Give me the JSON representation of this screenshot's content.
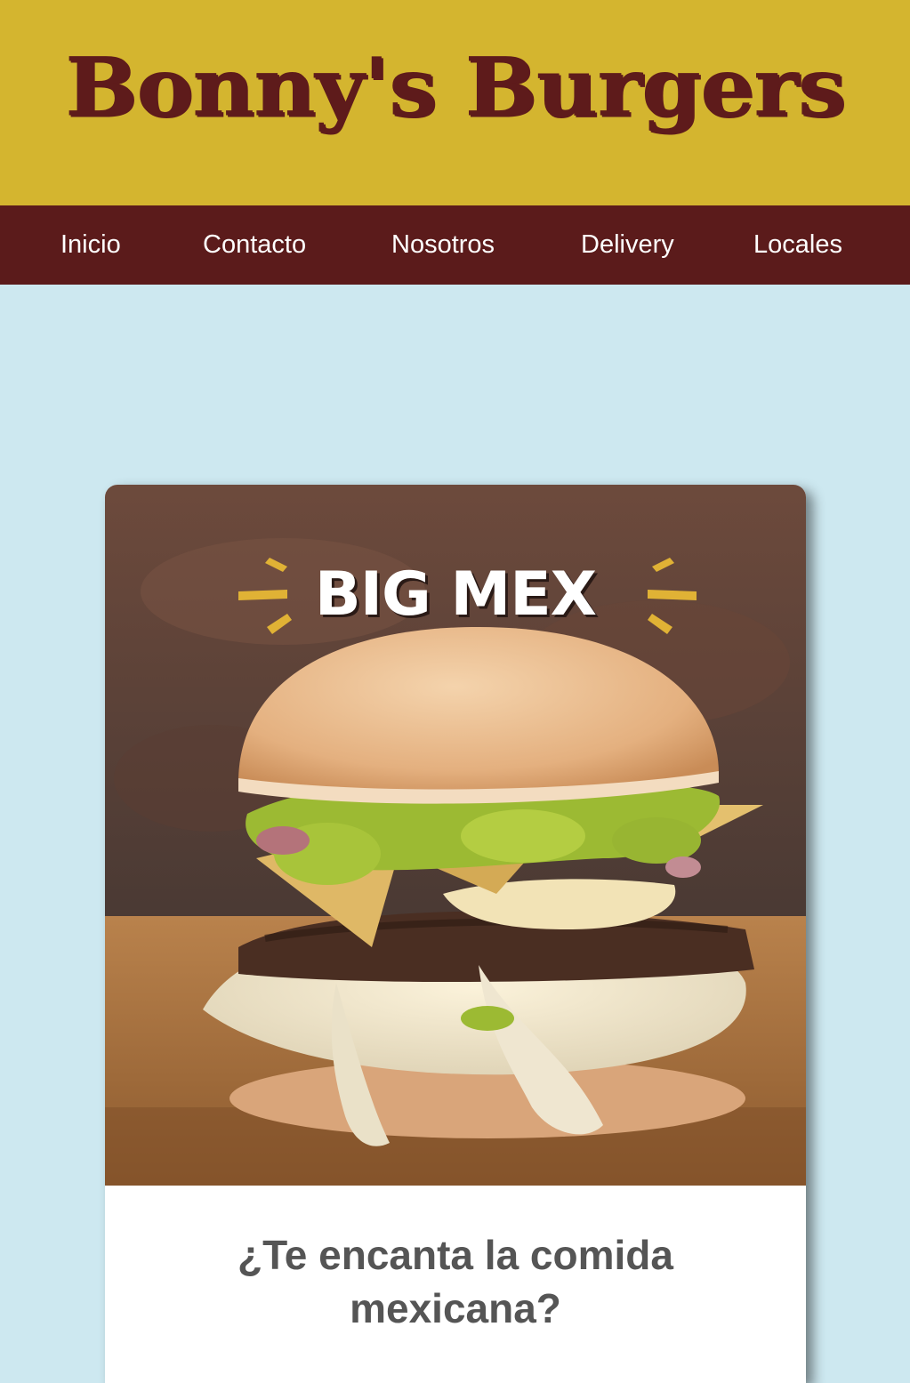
{
  "header": {
    "brand": "Bonny's Burgers"
  },
  "nav": {
    "items": [
      {
        "label": "Inicio"
      },
      {
        "label": "Contacto"
      },
      {
        "label": "Nosotros"
      },
      {
        "label": "Delivery"
      },
      {
        "label": "Locales"
      }
    ]
  },
  "promo": {
    "image_title": "BIG MEX",
    "question_line1": "¿Te encanta la comida",
    "question_line2": "mexicana?"
  },
  "colors": {
    "header_bg": "#d4b52f",
    "brand_text": "#5e1b1b",
    "nav_bg": "#5b1b1b",
    "page_bg": "#cde8f0",
    "card_bg": "#ffffff",
    "accent_burst": "#e0b235"
  },
  "icons": {
    "title_burst_left": "burst-left-icon",
    "title_burst_right": "burst-right-icon"
  }
}
